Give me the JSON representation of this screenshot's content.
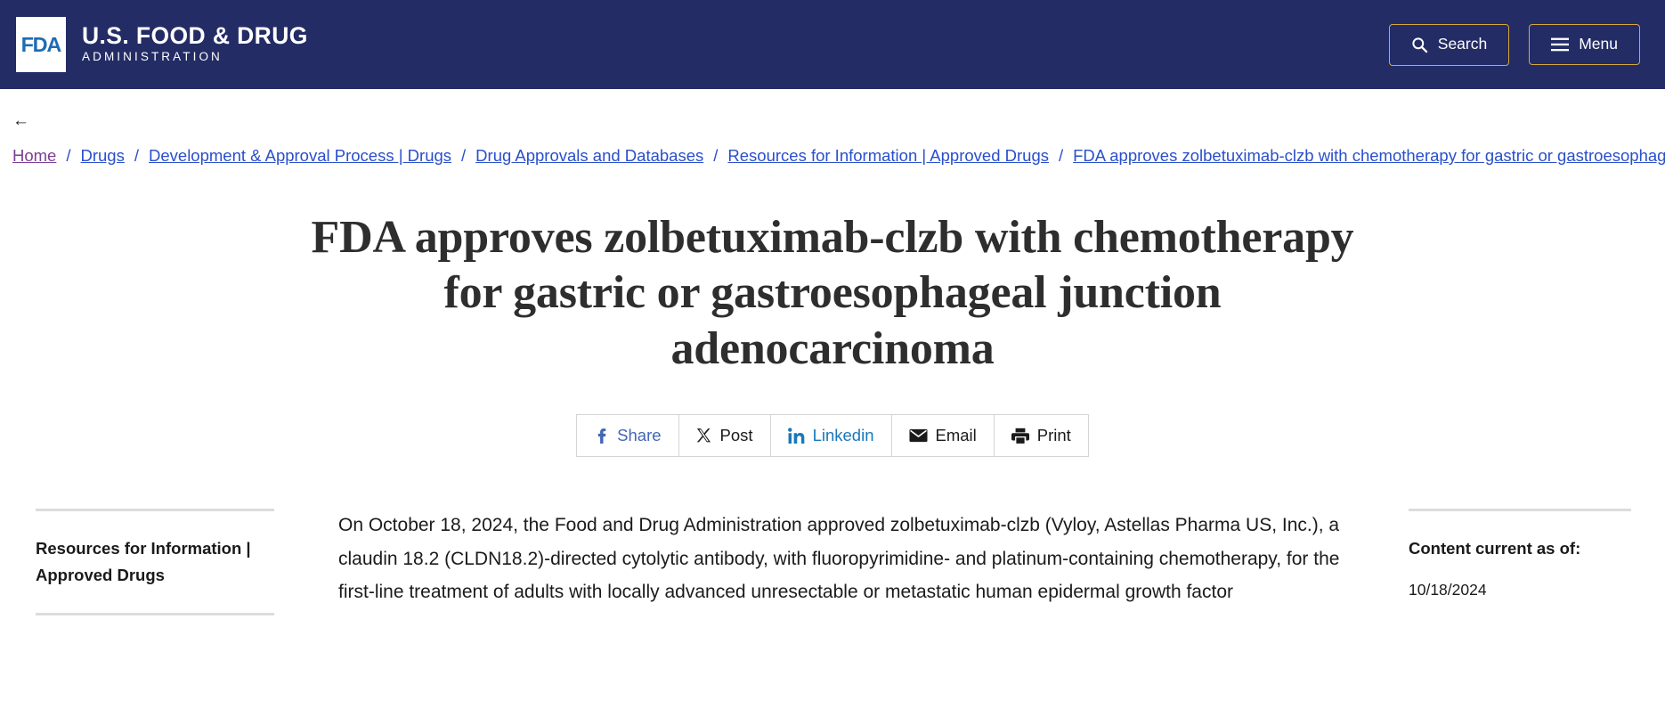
{
  "header": {
    "logo_mark_text": "FDA",
    "brand_line1": "U.S. FOOD & DRUG",
    "brand_line2": "ADMINISTRATION",
    "search_label": "Search",
    "menu_label": "Menu",
    "search_icon": "search-icon",
    "menu_icon": "hamburger-icon",
    "background_color": "#232C65",
    "button_border_color": "#D6A93B"
  },
  "breadcrumb": {
    "back_arrow": "←",
    "separator": "/",
    "items": [
      {
        "label": "Home",
        "visited": true
      },
      {
        "label": "Drugs",
        "visited": false
      },
      {
        "label": "Development & Approval Process | Drugs",
        "visited": false
      },
      {
        "label": "Drug Approvals and Databases",
        "visited": false
      },
      {
        "label": "Resources for Information | Approved Drugs",
        "visited": false
      },
      {
        "label": "FDA approves zolbetuximab-clzb with chemotherapy for gastric or gastroesophageal junction adenocarcinoma",
        "visited": false
      }
    ],
    "link_color": "#2A4FCB",
    "visited_color": "#7B3E96"
  },
  "page": {
    "title": "FDA approves zolbetuximab-clzb with chemotherapy for gastric or gastroesophageal junction adenocarcinoma"
  },
  "share_bar": {
    "buttons": [
      {
        "label": "Share",
        "icon": "facebook-icon",
        "style": "blue"
      },
      {
        "label": "Post",
        "icon": "x-twitter-icon",
        "style": "dark"
      },
      {
        "label": "Linkedin",
        "icon": "linkedin-icon",
        "style": "lblue"
      },
      {
        "label": "Email",
        "icon": "envelope-icon",
        "style": "dark"
      },
      {
        "label": "Print",
        "icon": "printer-icon",
        "style": "dark"
      }
    ]
  },
  "left_sidebar": {
    "heading": "Resources for Information | Approved Drugs"
  },
  "main": {
    "paragraph": "On October 18, 2024, the Food and Drug Administration approved zolbetuximab-clzb (Vyloy, Astellas Pharma US, Inc.), a claudin 18.2 (CLDN18.2)-directed cytolytic antibody, with fluoropyrimidine- and platinum-containing chemotherapy, for the first-line treatment of adults with locally advanced unresectable or metastatic human epidermal growth factor"
  },
  "right_sidebar": {
    "heading": "Content current as of:",
    "date": "10/18/2024"
  }
}
